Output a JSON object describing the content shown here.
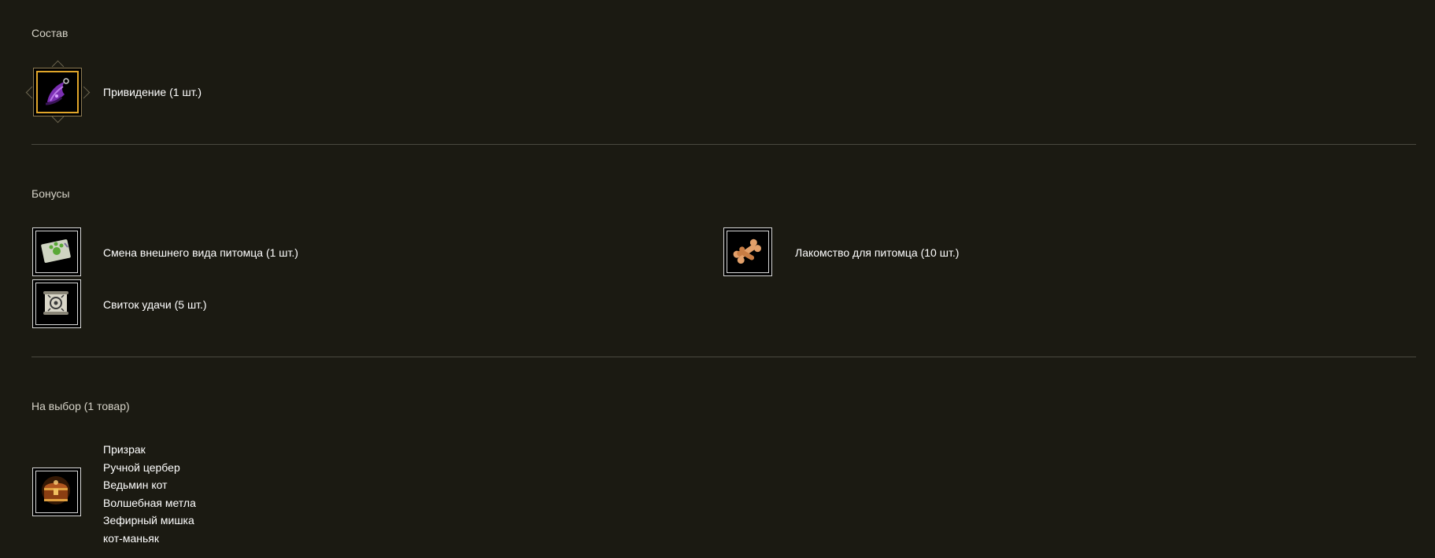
{
  "sections": {
    "composition": {
      "title": "Состав",
      "items": [
        {
          "label": "Привидение (1 шт.)",
          "icon": "ghost-hat-icon"
        }
      ]
    },
    "bonuses": {
      "title": "Бонусы",
      "items": [
        {
          "label": "Смена внешнего вида питомца (1 шт.)",
          "icon": "pet-appearance-ticket-icon"
        },
        {
          "label": "Лакомство для питомца (10 шт.)",
          "icon": "bone-treat-icon"
        },
        {
          "label": "Свиток удачи (5 шт.)",
          "icon": "luck-scroll-icon"
        }
      ]
    },
    "choice": {
      "title": "На выбор (1 товар)",
      "icon": "treasure-chest-icon",
      "options": [
        "Призрак",
        "Ручной цербер",
        "Ведьмин кот",
        "Волшебная метла",
        "Зефирный мишка",
        "кот-маньяк"
      ]
    }
  },
  "colors": {
    "background": "#1b1a12",
    "divider": "#4a4940",
    "frame": "#d8d8d8",
    "highlight_frame": "#e0a52a"
  }
}
